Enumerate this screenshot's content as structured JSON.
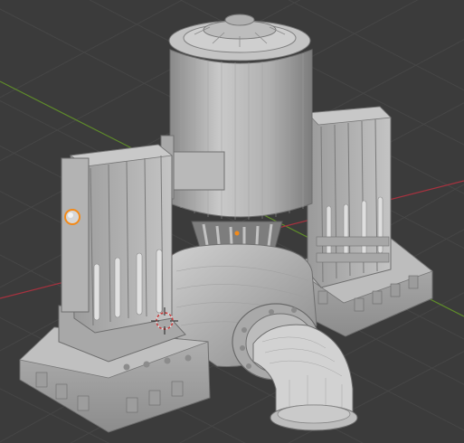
{
  "viewport": {
    "kind": "3d-viewport",
    "background_color": "#3b3b3b",
    "grid_color": "#454545",
    "x_axis_color": "#a8323f",
    "y_axis_color": "#5f8c2a",
    "model_color": "#b8b8b8",
    "model_shade_color": "#8f8f8f",
    "selection_color": "#f28a1a",
    "cursor_color": "#e0e0e0"
  },
  "icons": {
    "cursor": "3d-cursor-icon",
    "origin": "object-origin-icon"
  }
}
